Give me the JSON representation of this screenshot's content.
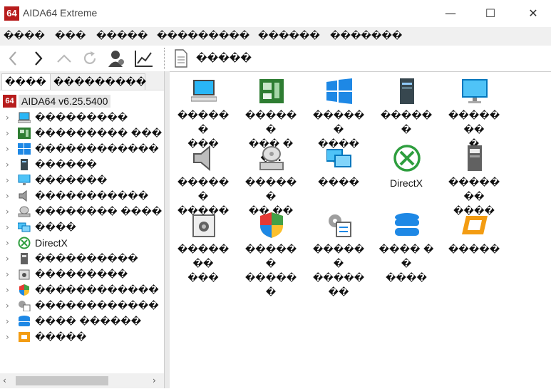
{
  "window": {
    "title": "AIDA64 Extreme",
    "logo": "64",
    "minimize": "—",
    "maximize": "☐",
    "close": "✕"
  },
  "menu": [
    "����",
    "���",
    "�����",
    "���������",
    "������",
    "�������"
  ],
  "toolbar": {
    "page_title": "�����"
  },
  "tabs": [
    {
      "label": "����"
    },
    {
      "label": "���������"
    }
  ],
  "tree": {
    "root": {
      "logo": "64",
      "label": "AIDA64 v6.25.5400"
    },
    "items": [
      {
        "label": "���������",
        "icon": "computer-icon"
      },
      {
        "label": "��������� ���",
        "icon": "motherboard-icon"
      },
      {
        "label": "������������",
        "icon": "windows-icon"
      },
      {
        "label": "������",
        "icon": "server-icon"
      },
      {
        "label": "�������",
        "icon": "monitor-icon"
      },
      {
        "label": "�����������",
        "icon": "speaker-icon"
      },
      {
        "label": "�������� ����",
        "icon": "drive-icon"
      },
      {
        "label": "����",
        "icon": "network-icon"
      },
      {
        "label": "DirectX",
        "icon": "directx-icon"
      },
      {
        "label": "����������",
        "icon": "storage-icon"
      },
      {
        "label": "���������",
        "icon": "programs-icon"
      },
      {
        "label": "������������",
        "icon": "security-icon"
      },
      {
        "label": "������������",
        "icon": "config-icon"
      },
      {
        "label": "���� ������",
        "icon": "database-icon"
      },
      {
        "label": "�����",
        "icon": "benchmark-icon"
      }
    ]
  },
  "grid": [
    {
      "line1": "������",
      "line2": "���",
      "icon": "computer-icon"
    },
    {
      "line1": "������",
      "line2": "��� ��...",
      "icon": "motherboard-icon"
    },
    {
      "line1": "������",
      "line2": "�����...",
      "icon": "windows-icon"
    },
    {
      "line1": "������",
      "line2": "",
      "icon": "server-icon"
    },
    {
      "line1": "�������",
      "line2": "�",
      "icon": "monitor-icon"
    },
    {
      "line1": "������",
      "line2": "�����",
      "icon": "speaker-icon"
    },
    {
      "line1": "������",
      "line2": "�� ���...",
      "icon": "drive-icon"
    },
    {
      "line1": "����",
      "line2": "",
      "icon": "network-icon"
    },
    {
      "line1": "DirectX",
      "line2": "",
      "icon": "directx-icon"
    },
    {
      "line1": "�������",
      "line2": "����",
      "icon": "storage-icon"
    },
    {
      "line1": "�������",
      "line2": "���",
      "icon": "programs-icon"
    },
    {
      "line1": "������",
      "line2": "������",
      "icon": "security-icon"
    },
    {
      "line1": "������",
      "line2": "�������",
      "icon": "config-icon"
    },
    {
      "line1": "���� ��",
      "line2": "����",
      "icon": "database-icon"
    },
    {
      "line1": "�����",
      "line2": "",
      "icon": "benchmark-icon"
    }
  ],
  "colors": {
    "brand": "#b71c1c",
    "accent_blue": "#1e88e5",
    "green": "#2e7d32",
    "orange": "#f39c12"
  }
}
